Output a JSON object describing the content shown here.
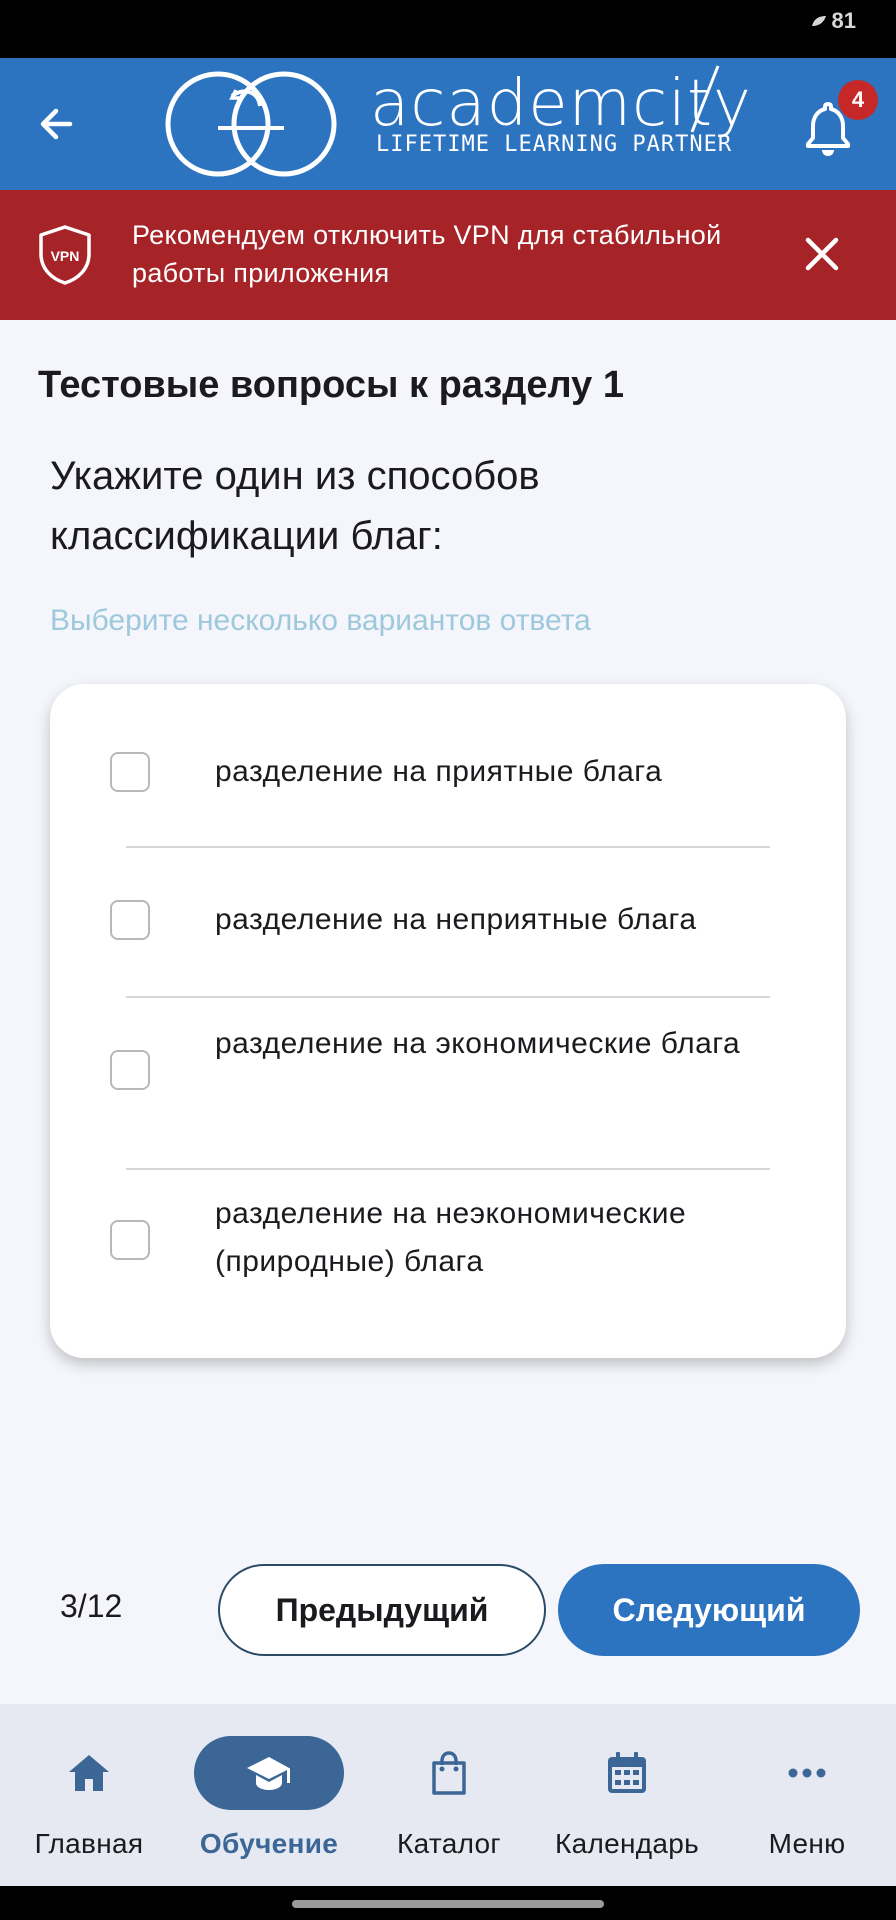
{
  "status_bar": {
    "battery": "81"
  },
  "header": {
    "logo_name": "academcity",
    "logo_tagline": "LIFETIME LEARNING PARTNER",
    "notification_count": "4",
    "brand_color": "#2c73c0"
  },
  "vpn_banner": {
    "icon_label": "VPN",
    "text": "Рекомендуем отключить VPN для стабильной работы приложения",
    "color": "#a62428"
  },
  "test": {
    "section_title": "Тестовые вопросы к разделу 1",
    "question": "Укажите один из способов классификации благ:",
    "hint": "Выберите несколько вариантов ответа",
    "options": [
      {
        "label": "разделение на приятные блага",
        "checked": false
      },
      {
        "label": "разделение на неприятные блага",
        "checked": false
      },
      {
        "label": "разделение на экономические блага",
        "checked": false
      },
      {
        "label": "разделение на неэкономические (природные) блага",
        "checked": false
      }
    ]
  },
  "pagination": {
    "counter": "3/12",
    "prev_label": "Предыдущий",
    "next_label": "Следующий"
  },
  "bottom_nav": {
    "items": [
      {
        "label": "Главная",
        "icon": "home-icon",
        "active": false
      },
      {
        "label": "Обучение",
        "icon": "graduation-cap-icon",
        "active": true
      },
      {
        "label": "Каталог",
        "icon": "shopping-bag-icon",
        "active": false
      },
      {
        "label": "Календарь",
        "icon": "calendar-icon",
        "active": false
      },
      {
        "label": "Меню",
        "icon": "more-dots-icon",
        "active": false
      }
    ],
    "active_color": "#3b6696"
  }
}
